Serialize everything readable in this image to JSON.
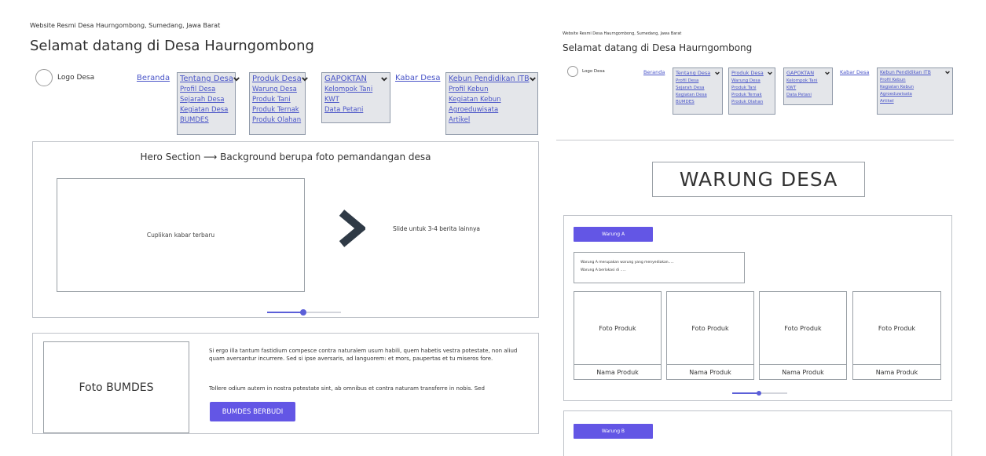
{
  "site": {
    "subtitle": "Website Resmi Desa Haurngombong, Sumedang, Jawa Barat",
    "title": "Selamat datang di Desa Haurngombong",
    "logo_label": "Logo Desa"
  },
  "nav": {
    "beranda": "Beranda",
    "kabar_desa": "Kabar Desa",
    "tentang": {
      "label": "Tentang Desa",
      "items": [
        "Profil Desa",
        "Sejarah Desa",
        "Kegiatan Desa",
        "BUMDES"
      ]
    },
    "produk": {
      "label": "Produk Desa",
      "items": [
        "Warung Desa",
        "Produk Tani",
        "Produk Ternak",
        "Produk Olahan"
      ]
    },
    "gapoktan": {
      "label": "GAPOKTAN",
      "items": [
        "Kelompok Tani",
        "KWT",
        "Data Petani"
      ]
    },
    "kebun": {
      "label": "Kebun Pendidikan ITB",
      "items": [
        "Profil Kebun",
        "Kegiatan Kebun",
        "Agroeduwisata",
        "Artikel"
      ]
    }
  },
  "hero": {
    "title": "Hero Section ⟶ Background berupa foto pemandangan desa",
    "news_placeholder": "Cuplikan kabar terbaru",
    "slide_hint": "Slide untuk 3-4 berita lainnya",
    "carousel_progress": 0.49
  },
  "bumdes": {
    "photo_label": "Foto BUMDES",
    "paragraph1": "Si ergo illa tantum fastidium compesce contra naturalem usum habili, quem habetis vestra potestate, non aliud quam aversantur incurrere. Sed si ipse aversaris, ad languorem: et mors, paupertas et tu miseros fore.",
    "paragraph2": "Tollere odium autem in nostra potestate sint, ab omnibus et contra naturam transferre in nobis. Sed",
    "button_label": "BUMDES BERBUDI"
  },
  "warung_page": {
    "title": "WARUNG DESA",
    "warung_a": {
      "button_label": "Warung A",
      "desc_line1": "Warung A merupakan warung yang menyediakan.....",
      "desc_line2": "Warung A berlokasi di .....",
      "products": [
        {
          "photo": "Foto Produk",
          "name": "Nama Produk"
        },
        {
          "photo": "Foto Produk",
          "name": "Nama Produk"
        },
        {
          "photo": "Foto Produk",
          "name": "Nama Produk"
        },
        {
          "photo": "Foto Produk",
          "name": "Nama Produk"
        }
      ],
      "carousel_progress": 0.49
    },
    "warung_b": {
      "button_label": "Warung B"
    }
  },
  "colors": {
    "accent": "#6356e5",
    "link": "#4a55c8",
    "dropdown_bg": "#e4e6ea"
  }
}
